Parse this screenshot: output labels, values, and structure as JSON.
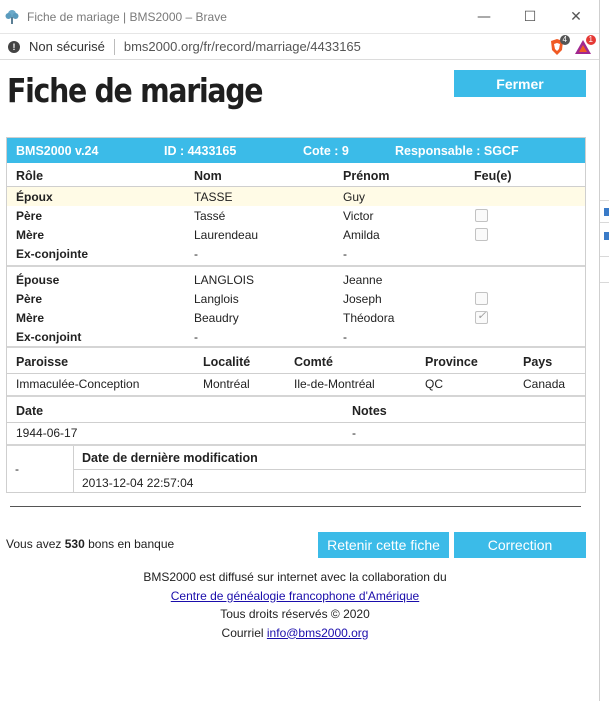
{
  "window": {
    "title": "Fiche de mariage | BMS2000 – Brave",
    "minimize_glyph": "—",
    "maximize_glyph": "☐",
    "close_glyph": "✕"
  },
  "address_bar": {
    "security_label": "Non sécurisé",
    "url": "bms2000.org/fr/record/marriage/4433165",
    "brave_badge": "4",
    "rewards_badge": "1"
  },
  "page": {
    "title": "Fiche de mariage",
    "close_button": "Fermer"
  },
  "record": {
    "header": {
      "version": "BMS2000 v.24",
      "id": "ID : 4433165",
      "cote": "Cote : 9",
      "responsable": "Responsable : SGCF"
    },
    "columns": {
      "role": "Rôle",
      "nom": "Nom",
      "prenom": "Prénom",
      "feu": "Feu(e)"
    },
    "groom": [
      {
        "role": "Époux",
        "nom": "TASSE",
        "prenom": "Guy"
      },
      {
        "role": "Père",
        "nom": "Tassé",
        "prenom": "Victor",
        "deceased": false
      },
      {
        "role": "Mère",
        "nom": "Laurendeau",
        "prenom": "Amilda",
        "deceased": false
      },
      {
        "role": "Ex-conjointe",
        "nom": "-",
        "prenom": "-"
      }
    ],
    "bride": [
      {
        "role": "Épouse",
        "nom": "LANGLOIS",
        "prenom": "Jeanne"
      },
      {
        "role": "Père",
        "nom": "Langlois",
        "prenom": "Joseph",
        "deceased": false
      },
      {
        "role": "Mère",
        "nom": "Beaudry",
        "prenom": "Théodora",
        "deceased": true
      },
      {
        "role": "Ex-conjoint",
        "nom": "-",
        "prenom": "-"
      }
    ],
    "place_columns": {
      "paroisse": "Paroisse",
      "localite": "Localité",
      "comte": "Comté",
      "province": "Province",
      "pays": "Pays"
    },
    "place": {
      "paroisse": "Immaculée-Conception",
      "localite": "Montréal",
      "comte": "Ile-de-Montréal",
      "province": "QC",
      "pays": "Canada"
    },
    "date_columns": {
      "date": "Date",
      "notes": "Notes"
    },
    "date": {
      "date": "1944-06-17",
      "notes": "-"
    },
    "modification": {
      "left": "-",
      "label": "Date de dernière modification",
      "value": "2013-12-04 22:57:04"
    }
  },
  "bank": {
    "prefix": "Vous avez",
    "count": "530",
    "suffix": "bons en banque"
  },
  "actions": {
    "retain": "Retenir cette fiche",
    "correction": "Correction"
  },
  "footer": {
    "line1": "BMS2000 est diffusé sur internet avec la collaboration du",
    "link": "Centre de généalogie francophone d'Amérique",
    "rights": "Tous droits réservés © 2020",
    "mail_prefix": "Courriel",
    "mail": "info@bms2000.org"
  },
  "colors": {
    "accent": "#3bbbe8",
    "highlight_row": "#fffbe6",
    "link": "#1a0dab"
  }
}
